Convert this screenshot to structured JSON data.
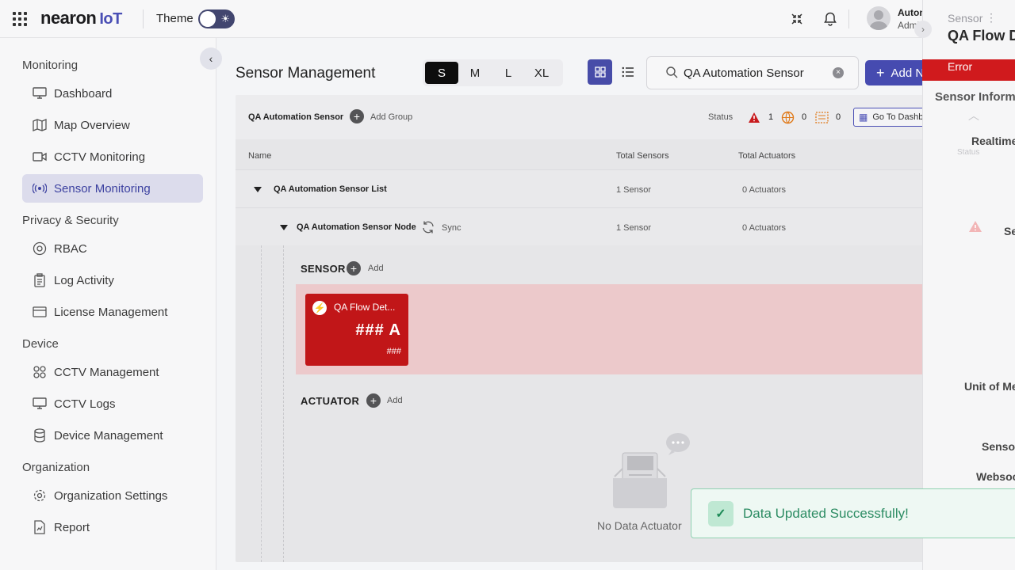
{
  "header": {
    "logo_text": "nearon",
    "logo_suffix": "IoT",
    "theme_label": "Theme",
    "user_name": "Automation S",
    "user_role": "Administrator"
  },
  "sidebar": {
    "sections": [
      {
        "title": "Monitoring",
        "items": [
          {
            "label": "Dashboard",
            "icon": "monitor-icon"
          },
          {
            "label": "Map Overview",
            "icon": "map-icon"
          },
          {
            "label": "CCTV Monitoring",
            "icon": "video-icon"
          },
          {
            "label": "Sensor Monitoring",
            "icon": "sensor-icon",
            "active": true
          }
        ]
      },
      {
        "title": "Privacy & Security",
        "items": [
          {
            "label": "RBAC",
            "icon": "at-icon"
          },
          {
            "label": "Log Activity",
            "icon": "clipboard-icon"
          },
          {
            "label": "License Management",
            "icon": "card-icon"
          }
        ]
      },
      {
        "title": "Device",
        "items": [
          {
            "label": "CCTV Management",
            "icon": "grid-icon"
          },
          {
            "label": "CCTV Logs",
            "icon": "monitor-icon"
          },
          {
            "label": "Device Management",
            "icon": "database-icon"
          }
        ]
      },
      {
        "title": "Organization",
        "items": [
          {
            "label": "Organization Settings",
            "icon": "gear-icon"
          },
          {
            "label": "Report",
            "icon": "report-icon"
          }
        ]
      }
    ]
  },
  "main": {
    "title": "Sensor Management",
    "sizes": [
      "S",
      "M",
      "L",
      "XL"
    ],
    "active_size": "S",
    "search_value": "QA Automation Sensor",
    "add_project_label": "Add New Project",
    "group": {
      "name": "QA Automation Sensor",
      "add_group_label": "Add Group",
      "status_label": "Status",
      "status_counts": {
        "error": "1",
        "offline": "0",
        "warning": "0"
      },
      "dashboard_label": "Go To Dashboard"
    },
    "columns": {
      "name": "Name",
      "total_sensors": "Total Sensors",
      "total_actuators": "Total Actuators"
    },
    "list_row": {
      "name": "QA Automation Sensor List",
      "sensors": "1 Sensor",
      "actuators": "0 Actuators"
    },
    "node_row": {
      "name": "QA Automation Sensor Node",
      "sync_label": "Sync",
      "sensors": "1 Sensor",
      "actuators": "0 Actuators"
    },
    "sensor_section": {
      "label": "SENSOR",
      "add_label": "Add"
    },
    "sensor_card": {
      "name": "QA Flow Det...",
      "value": "### A",
      "unit": "###"
    },
    "actuator_section": {
      "label": "ACTUATOR",
      "add_label": "Add"
    },
    "no_data_text": "No Data Actuator"
  },
  "drawer": {
    "type_label": "Sensor",
    "title": "QA Flow D",
    "status_badge": "Error",
    "info_heading": "Sensor Informa",
    "status_text": "Status",
    "realtime_label": "Realtime",
    "se_text": "Se",
    "unit_label": "Unit of Me",
    "sensor_label": "Senso",
    "websocket_label": "Websoc"
  },
  "toast": {
    "message": "Data Updated Successfully!"
  },
  "colors": {
    "accent": "#464bb0",
    "error": "#c11618",
    "success": "#2c8c63"
  }
}
